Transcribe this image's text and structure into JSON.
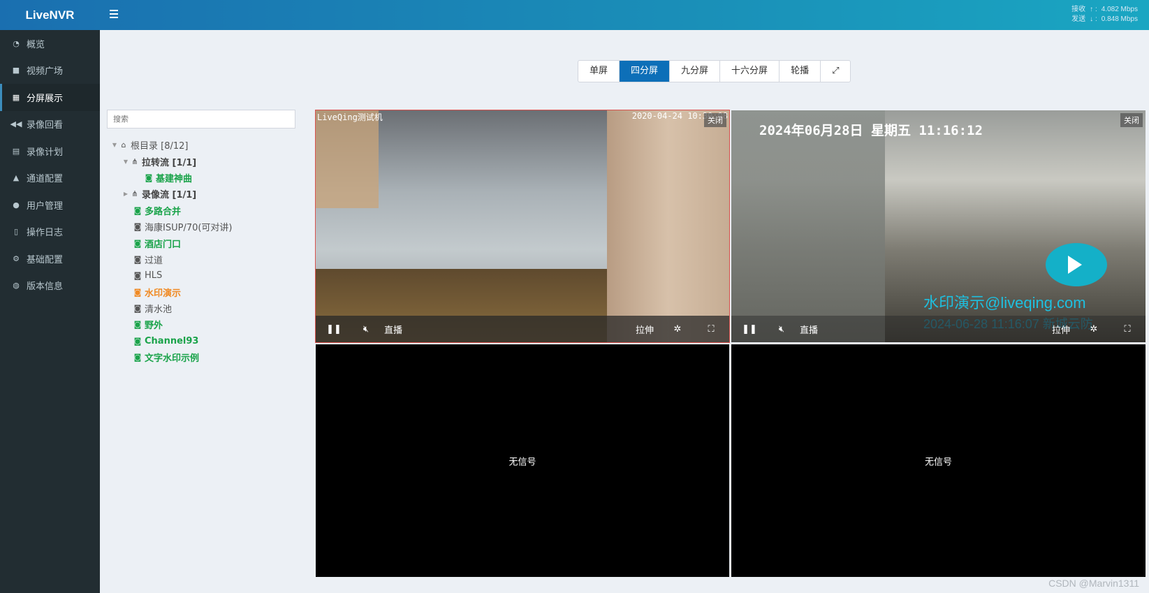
{
  "header": {
    "app_title": "LiveNVR",
    "net": {
      "recv_label": "接收",
      "recv_value": "4.082 Mbps",
      "send_label": "发送",
      "send_value": "0.848 Mbps"
    }
  },
  "sidebar": {
    "items": [
      {
        "label": "概览",
        "icon": "dashboard-icon"
      },
      {
        "label": "视频广场",
        "icon": "video-camera-icon"
      },
      {
        "label": "分屏展示",
        "icon": "grid-icon"
      },
      {
        "label": "录像回看",
        "icon": "backward-icon"
      },
      {
        "label": "录像计划",
        "icon": "calendar-icon"
      },
      {
        "label": "通道配置",
        "icon": "road-icon"
      },
      {
        "label": "用户管理",
        "icon": "users-icon"
      },
      {
        "label": "操作日志",
        "icon": "file-icon"
      },
      {
        "label": "基础配置",
        "icon": "cogs-icon"
      },
      {
        "label": "版本信息",
        "icon": "info-globe-icon"
      }
    ],
    "active_index": 2
  },
  "layout_buttons": [
    "单屏",
    "四分屏",
    "九分屏",
    "十六分屏",
    "轮播"
  ],
  "layout_active": "四分屏",
  "search": {
    "placeholder": "搜索"
  },
  "tree": {
    "root": "根目录 [8/12]",
    "group1": "拉转流 [1/1]",
    "group1_child": "基建神曲",
    "group2": "录像流 [1/1]",
    "channels": [
      {
        "label": "多路合并",
        "status": "online"
      },
      {
        "label": "海康ISUP/70(可对讲)",
        "status": "offline"
      },
      {
        "label": "酒店门口",
        "status": "online"
      },
      {
        "label": "过道",
        "status": "offline"
      },
      {
        "label": "HLS",
        "status": "offline"
      },
      {
        "label": "水印演示",
        "status": "playing"
      },
      {
        "label": "清水池",
        "status": "offline"
      },
      {
        "label": "野外",
        "status": "online"
      },
      {
        "label": "Channel93",
        "status": "online"
      },
      {
        "label": "文字水印示例",
        "status": "online"
      }
    ]
  },
  "players": {
    "close_label": "关闭",
    "live_label": "直播",
    "stretch_label": "拉伸",
    "no_signal": "无信号",
    "cell1": {
      "osd_left": "LiveQing测试机",
      "osd_right": "2020-04-24 10:30:08"
    },
    "cell2": {
      "osd_top": "2024年06月28日  星期五  11:16:12",
      "watermark": "水印演示@liveqing.com",
      "watermark_sub": "2024-06-28 11:16:07  新城云防"
    }
  },
  "footer_watermark": "CSDN @Marvin1311",
  "colors": {
    "accent": "#0d6fb8",
    "online": "#1aa34a",
    "playing": "#f08a24",
    "sidebar": "#222d32"
  }
}
